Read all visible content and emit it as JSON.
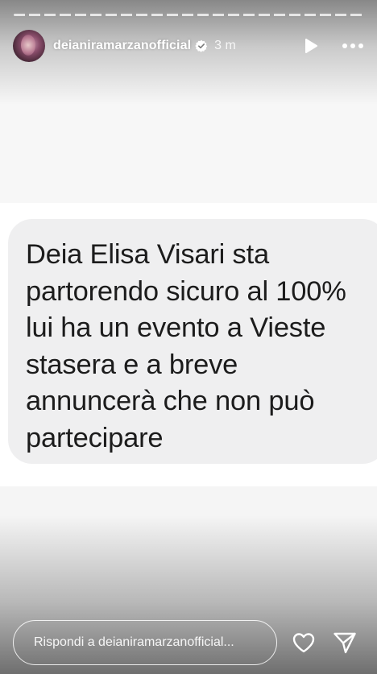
{
  "story": {
    "progress_fraction": 1.0,
    "segments": 1
  },
  "header": {
    "username": "deianiramarzanofficial",
    "time_ago": "3 m",
    "verified": true,
    "icons": [
      "avatar",
      "verified-badge-icon",
      "play-icon",
      "more-icon"
    ]
  },
  "message": {
    "text": "Deia Elisa Visari sta\npartorendo sicuro al 100%\nlui ha un evento a Vieste\nstasera e a breve\nannuncerà che non può\npartecipare"
  },
  "footer": {
    "reply_placeholder": "Rispondi a deianiramarzanofficial...",
    "icons": [
      "heart-icon",
      "send-icon"
    ]
  },
  "colors": {
    "bubble_bg": "#efeff0",
    "text": "#1c1c1c",
    "overlay_text": "#ffffff"
  }
}
